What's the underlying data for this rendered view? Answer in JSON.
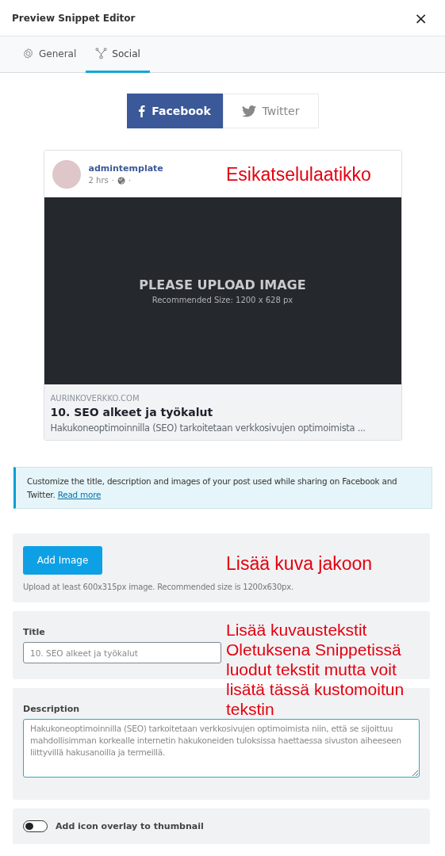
{
  "dialog": {
    "title": "Preview Snippet Editor",
    "close": "×"
  },
  "tabs": [
    {
      "label": "General",
      "selected": false
    },
    {
      "label": "Social",
      "selected": true
    }
  ],
  "networks": [
    {
      "label": "Facebook",
      "selected": true
    },
    {
      "label": "Twitter",
      "selected": false
    }
  ],
  "preview": {
    "author": "admintemplate",
    "time": "2 hrs",
    "separators": [
      "·",
      "·"
    ],
    "image_title": "PLEASE UPLOAD IMAGE",
    "image_hint": "Recommended Size: 1200 x 628 px",
    "domain": "AURINKOVERKKO.COM",
    "title": "10. SEO alkeet ja työkalut",
    "description": "Hakukoneoptimoinnilla (SEO) tarkoitetaan verkkosivujen optimoimista ..."
  },
  "notice": {
    "text": "Customize the title, description and images of your post used while sharing on Facebook and Twitter.",
    "link": "Read more"
  },
  "image_panel": {
    "button": "Add Image",
    "hint": "Upload at least 600x315px image. Recommended size is 1200x630px."
  },
  "title_field": {
    "label": "Title",
    "placeholder": "10. SEO alkeet ja työkalut"
  },
  "description_field": {
    "label": "Description",
    "placeholder": "Hakukoneoptimoinnilla (SEO) tarkoitetaan verkkosivujen optimoimista niin, että se sijoittuu mahdollisimman korkealle internetin hakukoneiden tuloksissa haettaessa sivuston aiheeseen liittyvillä hakusanoilla ja termeillä."
  },
  "overlay_toggle": {
    "label": "Add icon overlay to thumbnail",
    "on": false
  },
  "annotations": [
    "Esikatselulaatikko",
    "Lisää kuva jakoon",
    "Lisää kuvaustekstit Oletuksena Snippetissä luodut tekstit mutta voit lisätä tässä kustomoitun tekstin"
  ]
}
